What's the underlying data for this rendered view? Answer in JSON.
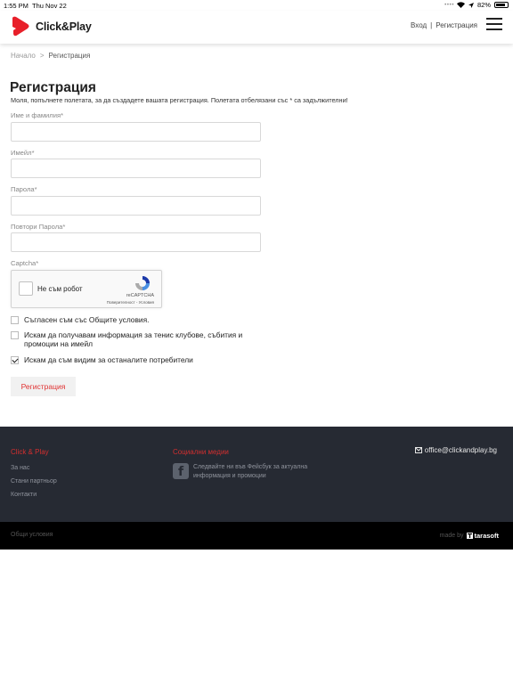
{
  "status_bar": {
    "time": "1:55 PM",
    "date": "Thu Nov 22",
    "battery": "82%",
    "battery_level": 0.82
  },
  "header": {
    "logo_text": "Click&Play",
    "login_label": "Вход",
    "separator": "|",
    "register_label": "Регистрация",
    "menu_icon": "hamburger-icon",
    "brand_color": "#e8202a"
  },
  "breadcrumb": {
    "home": "Начало",
    "separator": ">",
    "current": "Регистрация"
  },
  "form": {
    "title": "Регистрация",
    "subtitle": "Моля, попълнете полетата, за да създадете вашата регистрация. Полетата отбелязани със * са задължителни!",
    "fields": [
      {
        "label": "Име и фамилия*",
        "value": ""
      },
      {
        "label": "Имейл*",
        "value": ""
      },
      {
        "label": "Парола*",
        "value": ""
      },
      {
        "label": "Повтори Парола*",
        "value": ""
      }
    ],
    "captcha_label": "Captcha*",
    "captcha": {
      "checkbox_label": "Не съм робот",
      "brand": "reCAPTCHA",
      "terms": "Поверителност - Условия"
    },
    "checkboxes": [
      {
        "label": "Съгласен съм със Общите условия.",
        "checked": false
      },
      {
        "label": "Искам да получавам информация за тенис клубове, събития и промоции на имейл",
        "checked": false
      },
      {
        "label": "Искам да съм видим за останалите потребители",
        "checked": true
      }
    ],
    "submit_label": "Регистрация",
    "accent_color": "#e03030"
  },
  "footer": {
    "col1_title": "Click & Play",
    "links": [
      "За нас",
      "Стани партньор",
      "Контакти"
    ],
    "col2_title": "Социални медии",
    "facebook_text": "Следвайте ни във Фейсбук за актуална информация и промоции",
    "email": "office@clickandplay.bg",
    "terms": "Общи условия",
    "made_by": "made by",
    "made_by_brand": "tarasoft"
  }
}
